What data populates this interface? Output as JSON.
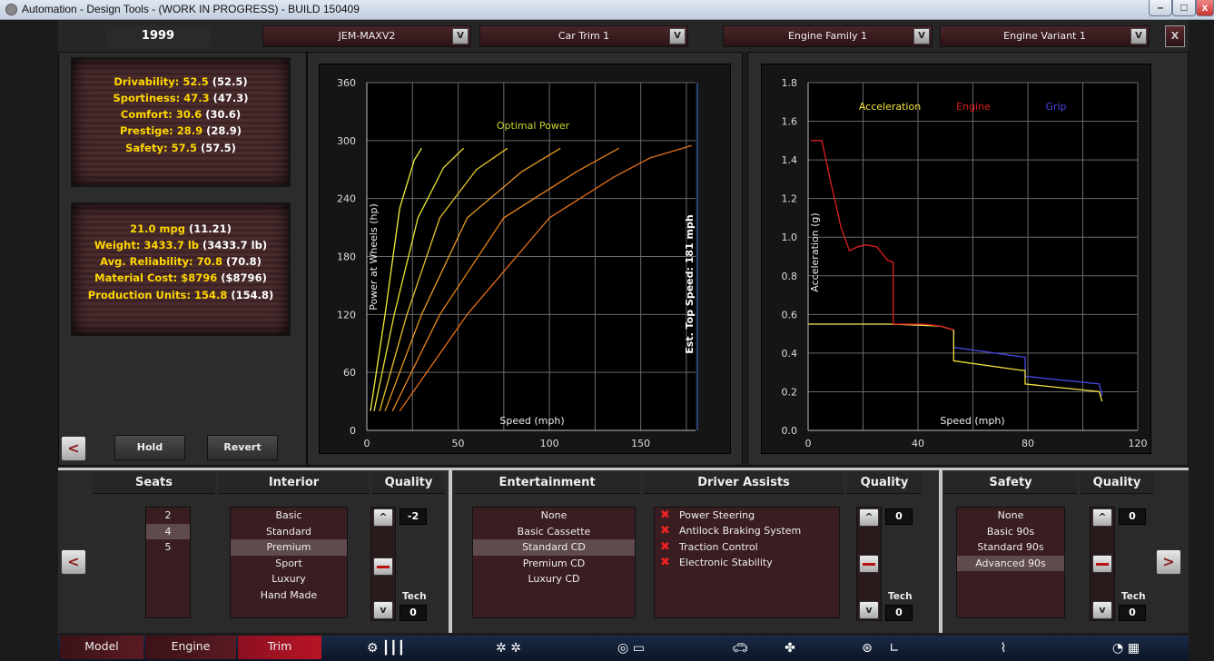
{
  "window": {
    "title": "Automation - Design Tools - (WORK IN PROGRESS) - BUILD 150409"
  },
  "header": {
    "year": "1999",
    "model": "JEM-MAXV2",
    "trim": "Car Trim 1",
    "engine_family": "Engine Family 1",
    "engine_variant": "Engine Variant 1",
    "dropdown_glyph": "V",
    "close_glyph": "X"
  },
  "stats1": [
    {
      "label": "Drivability: 52.5",
      "val": " (52.5)"
    },
    {
      "label": "Sportiness: 47.3",
      "val": " (47.3)"
    },
    {
      "label": "Comfort: 30.6",
      "val": " (30.6)"
    },
    {
      "label": "Prestige: 28.9",
      "val": " (28.9)"
    },
    {
      "label": "Safety: 57.5",
      "val": " (57.5)"
    }
  ],
  "stats2": [
    {
      "label": "21.0 mpg",
      "val": " (11.21)"
    },
    {
      "label": "Weight: 3433.7 lb",
      "val": " (3433.7 lb)"
    },
    {
      "label": "Avg. Reliability: 70.8",
      "val": " (70.8)"
    },
    {
      "label": "Material Cost: $8796",
      "val": " ($8796)"
    },
    {
      "label": "Production Units: 154.8",
      "val": " (154.8)"
    }
  ],
  "buttons": {
    "hold": "Hold",
    "revert": "Revert",
    "back": "<",
    "forward": ">"
  },
  "chart_data": [
    {
      "type": "line",
      "title": "Optimal Power",
      "xlabel": "Speed (mph)",
      "ylabel": "Power at Wheels (hp)",
      "annotation": "Est. Top Speed: 181 mph",
      "xlim": [
        0,
        180
      ],
      "ylim": [
        0,
        360
      ],
      "xticks": [
        "0",
        "50",
        "100",
        "150"
      ],
      "yticks": [
        "0",
        "60",
        "120",
        "180",
        "240",
        "300",
        "360"
      ],
      "grid": true,
      "series": [
        {
          "color": "#f2f23a",
          "x": [
            2,
            10,
            18,
            26,
            30
          ],
          "y": [
            20,
            120,
            230,
            280,
            292
          ]
        },
        {
          "color": "#e8e233",
          "x": [
            4,
            15,
            28,
            42,
            53
          ],
          "y": [
            20,
            120,
            220,
            272,
            292
          ]
        },
        {
          "color": "#e8c22a",
          "x": [
            7,
            22,
            40,
            60,
            77
          ],
          "y": [
            20,
            120,
            220,
            270,
            292
          ]
        },
        {
          "color": "#e89a25",
          "x": [
            10,
            30,
            55,
            85,
            106
          ],
          "y": [
            20,
            120,
            220,
            268,
            292
          ]
        },
        {
          "color": "#e88420",
          "x": [
            14,
            40,
            75,
            115,
            138
          ],
          "y": [
            20,
            120,
            220,
            268,
            292
          ]
        },
        {
          "color": "#e06f1c",
          "x": [
            18,
            55,
            100,
            135,
            155,
            178
          ],
          "y": [
            20,
            120,
            220,
            262,
            282,
            295
          ]
        }
      ],
      "est_top_speed": 181
    },
    {
      "type": "line",
      "xlabel": "Speed (mph)",
      "ylabel": "Acceleration (g)",
      "xlim": [
        0,
        120
      ],
      "ylim": [
        0.0,
        1.8
      ],
      "xticks": [
        "0",
        "40",
        "80",
        "120"
      ],
      "yticks": [
        "0.0",
        "0.2",
        "0.4",
        "0.6",
        "0.8",
        "1.0",
        "1.2",
        "1.4",
        "1.6",
        "1.8"
      ],
      "grid": true,
      "legend": [
        "Acceleration",
        "Engine",
        "Grip"
      ],
      "legend_colors": [
        "#f5e23a",
        "#e01e1e",
        "#4848e8"
      ],
      "series": [
        {
          "name": "Grip",
          "color": "#4848e8",
          "x": [
            0,
            30,
            48,
            53,
            53,
            78,
            79,
            79,
            106,
            107
          ],
          "y": [
            0.55,
            0.55,
            0.54,
            0.52,
            0.43,
            0.38,
            0.38,
            0.28,
            0.24,
            0.18
          ]
        },
        {
          "name": "Acceleration",
          "color": "#f5e23a",
          "x": [
            0,
            30,
            48,
            53,
            53,
            78,
            79,
            79,
            106,
            107
          ],
          "y": [
            0.55,
            0.55,
            0.54,
            0.52,
            0.36,
            0.31,
            0.31,
            0.24,
            0.2,
            0.15
          ]
        },
        {
          "name": "Engine",
          "color": "#e01e1e",
          "x": [
            1,
            5,
            8,
            12,
            15,
            18,
            21,
            25,
            29,
            31,
            31,
            42,
            48,
            53
          ],
          "y": [
            1.5,
            1.5,
            1.3,
            1.05,
            0.93,
            0.95,
            0.96,
            0.95,
            0.88,
            0.87,
            0.55,
            0.55,
            0.54,
            0.52
          ]
        }
      ]
    }
  ],
  "sections": {
    "seats": {
      "header": "Seats",
      "items": [
        "2",
        "4",
        "5"
      ],
      "selected": 1
    },
    "interior": {
      "header": "Interior",
      "items": [
        "Basic",
        "Standard",
        "Premium",
        "Sport",
        "Luxury",
        "Hand Made"
      ],
      "selected": 2
    },
    "quality1": {
      "header": "Quality",
      "value": "-2",
      "tech_label": "Tech",
      "tech_value": "0"
    },
    "entertainment": {
      "header": "Entertainment",
      "items": [
        "None",
        "Basic Cassette",
        "Standard CD",
        "Premium CD",
        "Luxury CD"
      ],
      "selected": 2
    },
    "driver_assists": {
      "header": "Driver Assists",
      "items": [
        "Power Steering",
        "Antilock Braking System",
        "Traction Control",
        "Electronic Stability"
      ]
    },
    "quality2": {
      "header": "Quality",
      "value": "0",
      "tech_label": "Tech",
      "tech_value": "0"
    },
    "safety": {
      "header": "Safety",
      "items": [
        "None",
        "Basic 90s",
        "Standard 90s",
        "Advanced 90s"
      ],
      "selected": 3
    },
    "quality3": {
      "header": "Quality",
      "value": "0",
      "tech_label": "Tech",
      "tech_value": "0"
    }
  },
  "arrows": {
    "up": "^",
    "down": "v"
  },
  "tabs": [
    "Model",
    "Engine",
    "Trim"
  ],
  "tab_icons": [
    "engine-block-icon",
    "wheels-icon",
    "tire-icon",
    "car-body-icon",
    "fan-icon",
    "steering-wheel-icon",
    "seat-icon",
    "suspension-icon",
    "gauge-finish-icon"
  ]
}
